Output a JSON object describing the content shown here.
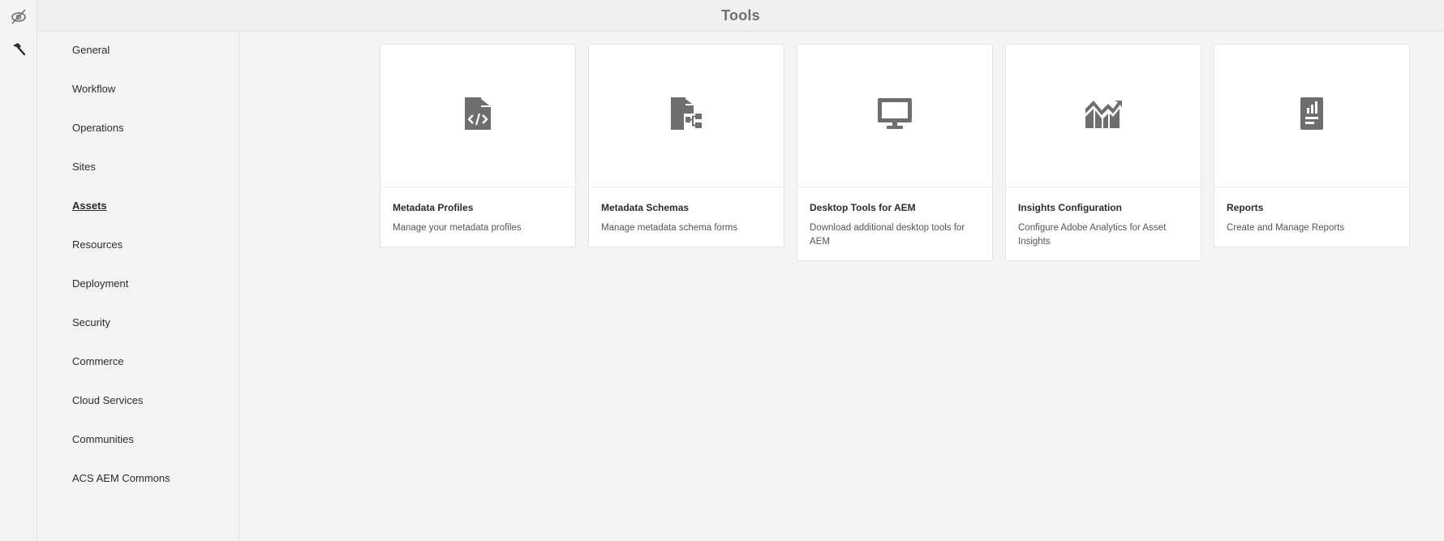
{
  "header": {
    "title": "Tools"
  },
  "rail": {
    "items": [
      {
        "icon": "compass-off-icon"
      },
      {
        "icon": "hammer-icon"
      }
    ]
  },
  "nav": {
    "items": [
      {
        "label": "General"
      },
      {
        "label": "Workflow"
      },
      {
        "label": "Operations"
      },
      {
        "label": "Sites"
      },
      {
        "label": "Assets",
        "active": true
      },
      {
        "label": "Resources"
      },
      {
        "label": "Deployment"
      },
      {
        "label": "Security"
      },
      {
        "label": "Commerce"
      },
      {
        "label": "Cloud Services"
      },
      {
        "label": "Communities"
      },
      {
        "label": "ACS AEM Commons"
      }
    ]
  },
  "cards": [
    {
      "title": "Metadata Profiles",
      "description": "Manage your metadata profiles",
      "icon": "file-code-icon"
    },
    {
      "title": "Metadata Schemas",
      "description": "Manage metadata schema forms",
      "icon": "file-schema-icon"
    },
    {
      "title": "Desktop Tools for AEM",
      "description": "Download additional desktop tools for AEM",
      "icon": "monitor-icon"
    },
    {
      "title": "Insights Configuration",
      "description": "Configure Adobe Analytics for Asset Insights",
      "icon": "insights-chart-icon"
    },
    {
      "title": "Reports",
      "description": "Create and Manage Reports",
      "icon": "report-icon"
    }
  ],
  "colors": {
    "icon": "#6e6e6e",
    "background": "#f4f4f4",
    "card": "#ffffff"
  }
}
